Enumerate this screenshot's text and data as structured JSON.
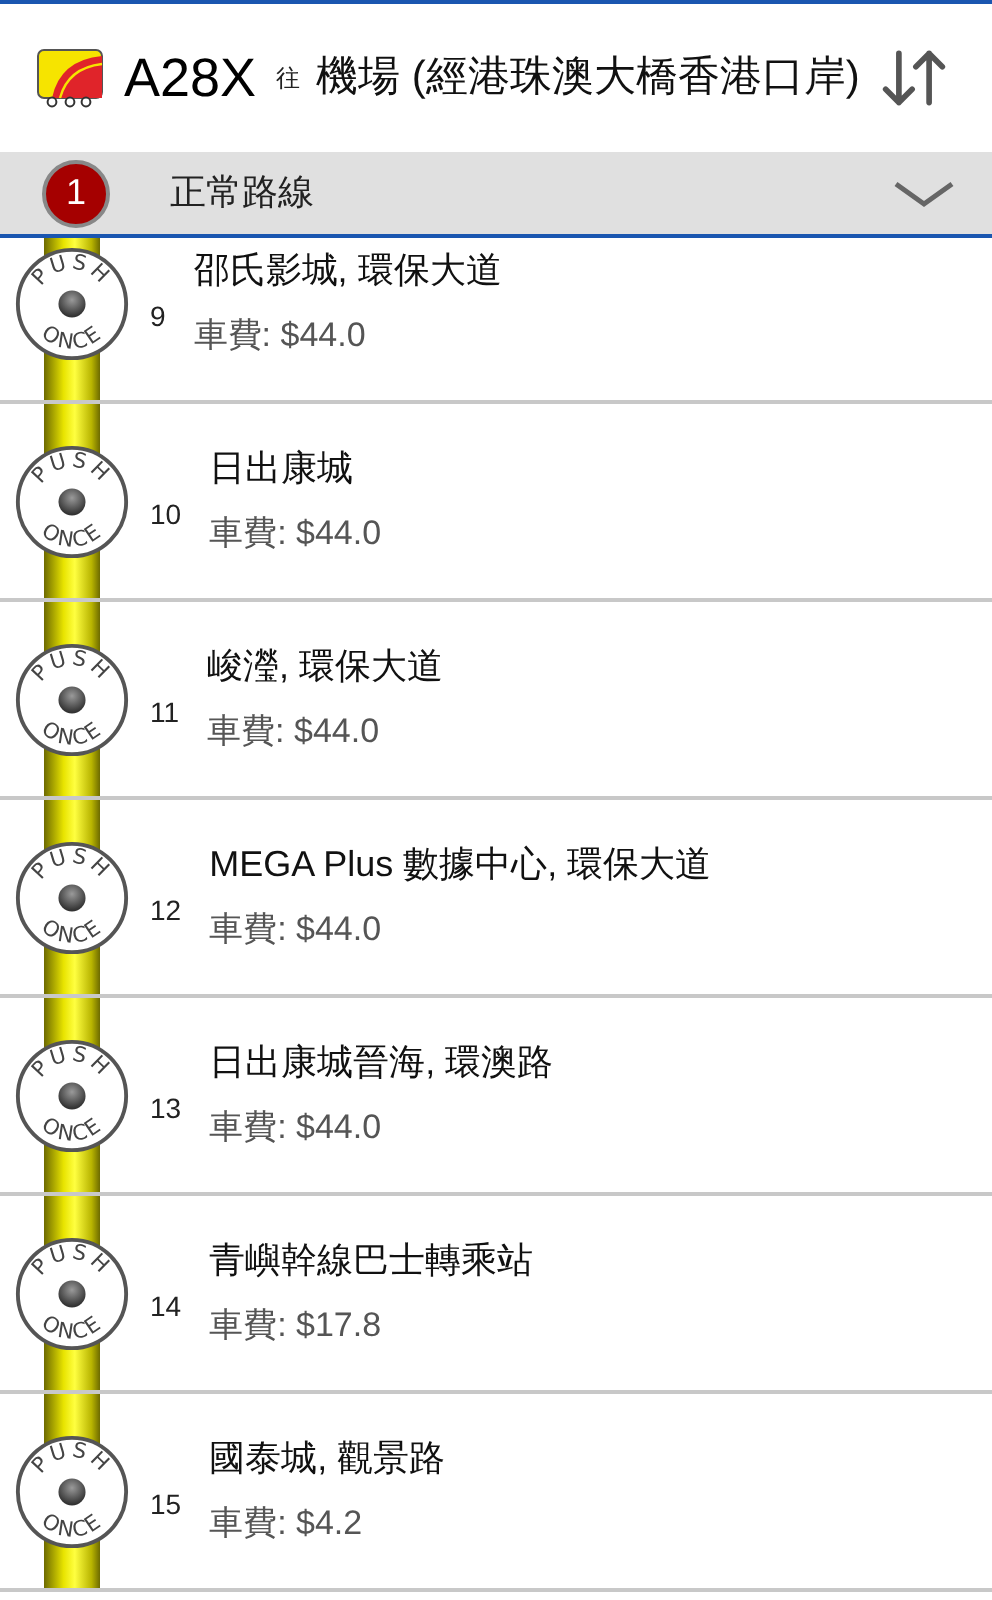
{
  "header": {
    "route": "A28X",
    "direction_word": "往",
    "destination": "機場 (經港珠澳大橋香港口岸)"
  },
  "route_bar": {
    "badge": "1",
    "label": "正常路線",
    "expanded": false
  },
  "stops": [
    {
      "seq": "9",
      "name": "邵氏影城, 環保大道",
      "fare": "車費: $44.0",
      "bell_top": "PUSH",
      "bell_bottom": "ONCE"
    },
    {
      "seq": "10",
      "name": "日出康城",
      "fare": "車費: $44.0",
      "bell_top": "PUSH",
      "bell_bottom": "ONCE"
    },
    {
      "seq": "11",
      "name": "峻瀅, 環保大道",
      "fare": "車費: $44.0",
      "bell_top": "PUSH",
      "bell_bottom": "ONCE"
    },
    {
      "seq": "12",
      "name": "MEGA Plus 數據中心, 環保大道",
      "fare": "車費: $44.0",
      "bell_top": "PUSH",
      "bell_bottom": "ONCE"
    },
    {
      "seq": "13",
      "name": "日出康城晉海, 環澳路",
      "fare": "車費: $44.0",
      "bell_top": "PUSH",
      "bell_bottom": "ONCE"
    },
    {
      "seq": "14",
      "name": "青嶼幹線巴士轉乘站",
      "fare": "車費: $17.8",
      "bell_top": "PUSH",
      "bell_bottom": "ONCE"
    },
    {
      "seq": "15",
      "name": "國泰城, 觀景路",
      "fare": "車費: $4.2",
      "bell_top": "PUSH",
      "bell_bottom": "ONCE"
    }
  ]
}
